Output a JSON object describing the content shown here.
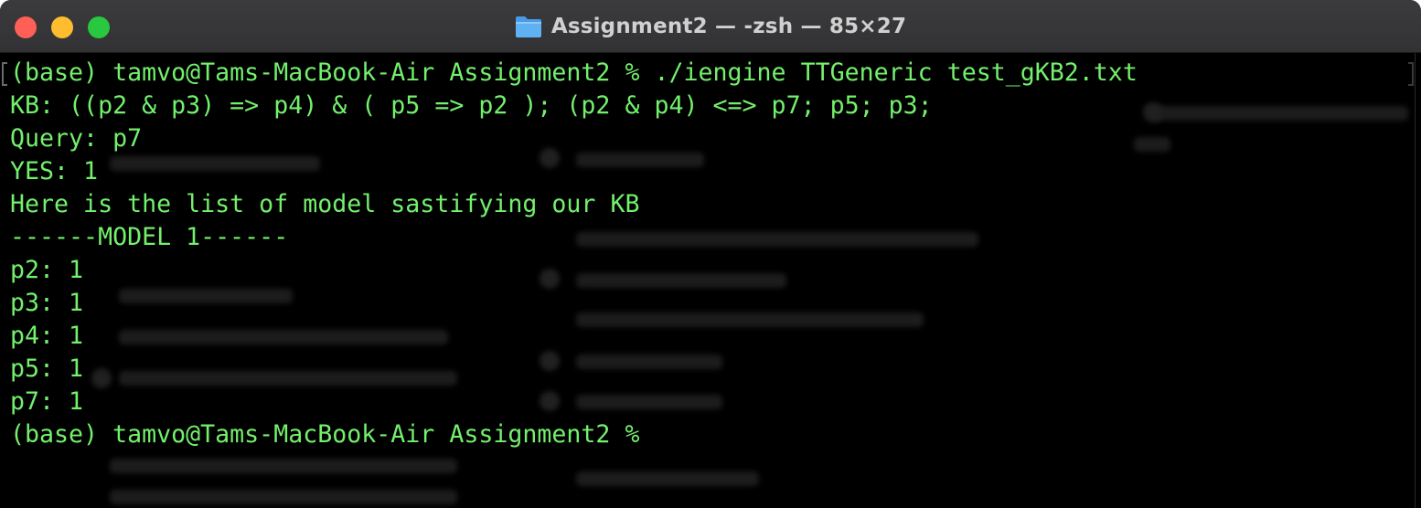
{
  "window": {
    "title": "Assignment2 — -zsh — 85×27",
    "folder_icon": "folder-icon",
    "buttons": {
      "close": "close-icon",
      "minimize": "minimize-icon",
      "zoom": "zoom-icon"
    }
  },
  "colors": {
    "terminal_text": "#73f06c",
    "terminal_background": "#000000",
    "titlebar": "#383839",
    "close": "#fe5f57",
    "minimize": "#febc2e",
    "zoom": "#28c840"
  },
  "terminal": {
    "lines": [
      "(base) tamvo@Tams-MacBook-Air Assignment2 % ./iengine TTGeneric test_gKB2.txt",
      "KB: ((p2 & p3) => p4) & ( p5 => p2 ); (p2 & p4) <=> p7; p5; p3;",
      "Query: p7",
      "YES: 1",
      "Here is the list of model sastifying our KB",
      "------MODEL 1------",
      "p2: 1",
      "p3: 1",
      "p4: 1",
      "p5: 1",
      "p7: 1",
      "(base) tamvo@Tams-MacBook-Air Assignment2 % "
    ]
  }
}
